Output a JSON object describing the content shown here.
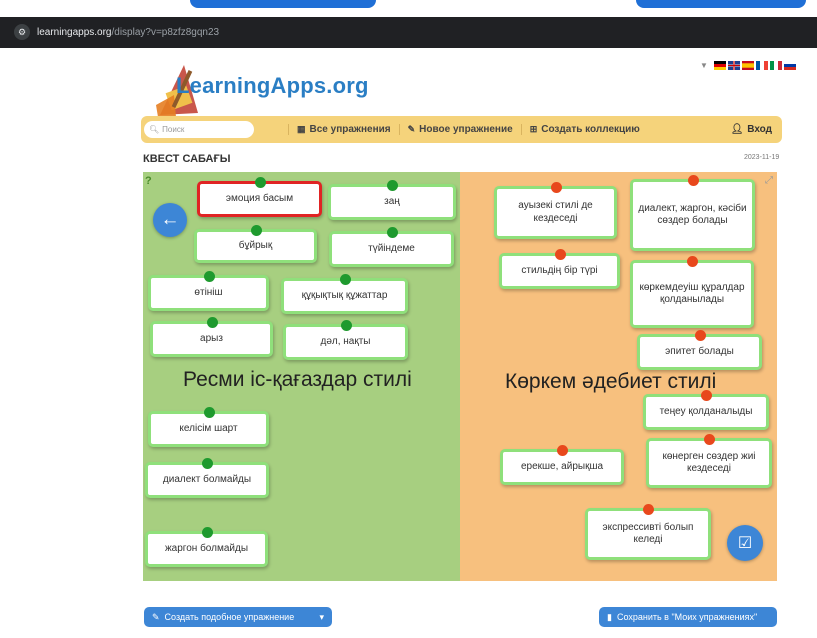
{
  "browser": {
    "host": "learningapps.org",
    "path": "/display?v=p8zfz8gqn23"
  },
  "header": {
    "logo_text": "LearningApps.org",
    "search_placeholder": "Поиск",
    "nav": [
      {
        "icon": "grid-icon",
        "label": "Все упражнения"
      },
      {
        "icon": "pencil-icon",
        "label": "Новое упражнение"
      },
      {
        "icon": "collection-icon",
        "label": "Создать коллекцию"
      }
    ],
    "login_label": "Вход"
  },
  "page": {
    "title": "КВЕСТ САБАҒЫ",
    "date": "2023-11-19"
  },
  "zones": {
    "left_title": "Ресми іс-қағаздар стилі",
    "right_title": "Көркем әдебиет стилі"
  },
  "cards": {
    "left": [
      "эмоция басым",
      "заң",
      "бұйрық",
      "түйіндеме",
      "өтініш",
      "құқықтық құжаттар",
      "арыз",
      "дәл, нақты",
      "келісім шарт",
      "диалект болмайды",
      "жаргон болмайды"
    ],
    "right": [
      "ауызекі стилі де кездеседі",
      "диалект, жаргон, кәсіби сөздер болады",
      "стильдің бір түрі",
      "көркемдеуіш құралдар қолданылады",
      "эпитет болады",
      "теңеу қолданалыды",
      "ерекше, айрықша",
      "көнерген сөздер жиі кездеседі",
      "экспрессивті болып келеді"
    ]
  },
  "footer": {
    "create_similar": "Создать подобное упражнение",
    "save_label": "Сохранить в \"Моих упражнениях\""
  },
  "colors": {
    "left_zone": "#a7cf80",
    "right_zone": "#f7c07e",
    "card_border": "#8fe07b",
    "selected_border": "#e02424",
    "pin_green": "#1e9a2e",
    "pin_red": "#e8481c",
    "accent_blue": "#3d86d6",
    "toolbar": "#f5d37b"
  }
}
